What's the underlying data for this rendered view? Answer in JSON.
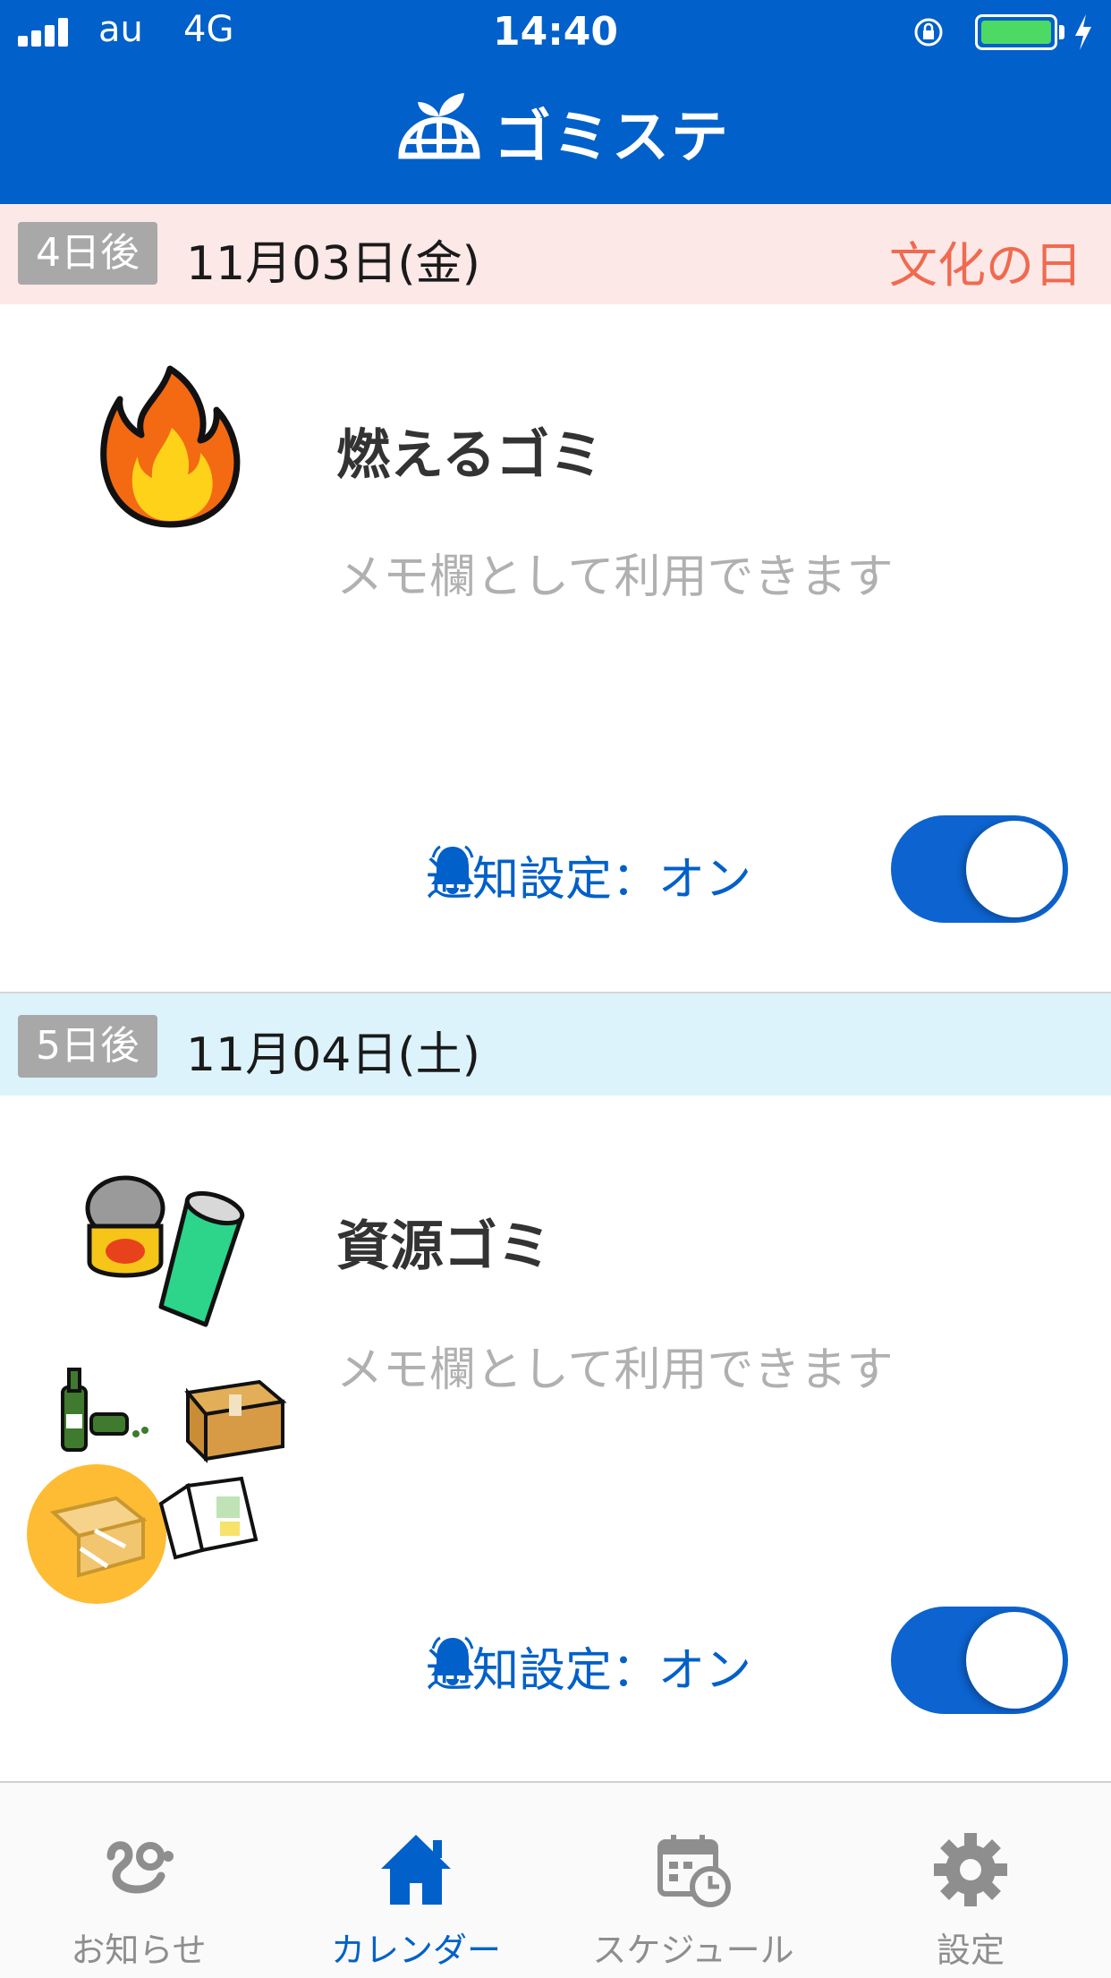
{
  "status_bar": {
    "carrier": "au",
    "network": "4G",
    "time": "14:40"
  },
  "header": {
    "title": "ゴミステ"
  },
  "days": [
    {
      "badge": "4日後",
      "date": "11月03日(金)",
      "holiday": "文化の日",
      "header_color": "#FDE8E8",
      "garbage_type": "燃えるゴミ",
      "memo_placeholder": "メモ欄として利用できます",
      "notification_label": "通知設定：オン",
      "notification_on": true,
      "icon": "fire-icon"
    },
    {
      "badge": "5日後",
      "date": "11月04日(土)",
      "holiday": "",
      "header_color": "#DCF3FC",
      "garbage_type": "資源ゴミ",
      "memo_placeholder": "メモ欄として利用できます",
      "notification_label": "通知設定：オン",
      "notification_on": true,
      "icon": "recyclables-icon"
    }
  ],
  "tabs": [
    {
      "label": "お知らせ",
      "icon": "news-icon",
      "active": false
    },
    {
      "label": "カレンダー",
      "icon": "home-icon",
      "active": true
    },
    {
      "label": "スケジュール",
      "icon": "calendar-clock-icon",
      "active": false
    },
    {
      "label": "設定",
      "icon": "gear-icon",
      "active": false
    }
  ],
  "colors": {
    "primary": "#0160C9",
    "holiday": "#F06A4F",
    "badge": "#A8A8A8"
  }
}
